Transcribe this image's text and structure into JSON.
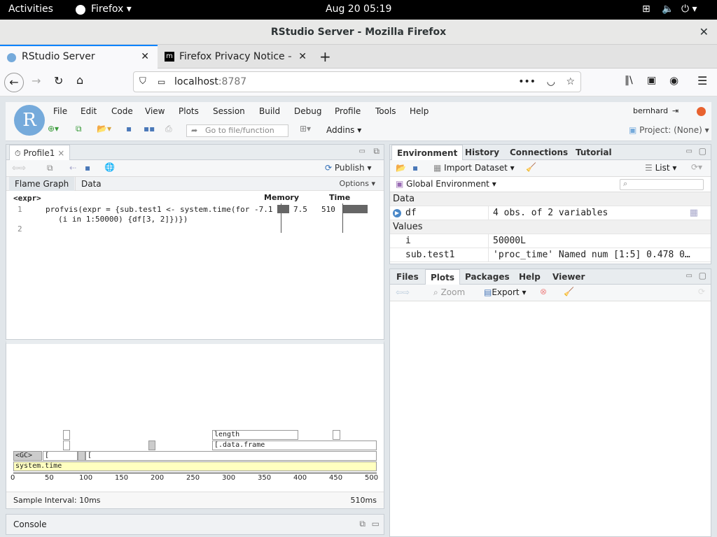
{
  "gnome": {
    "activities": "Activities",
    "app": "Firefox ▾",
    "clock": "Aug 20  05:19"
  },
  "window": {
    "title": "RStudio Server - Mozilla Firefox"
  },
  "browser": {
    "tabs": [
      {
        "label": "RStudio Server"
      },
      {
        "label": "Firefox Privacy Notice —"
      }
    ],
    "url_host": "localhost",
    "url_port": ":8787"
  },
  "rstudio": {
    "menu": [
      "File",
      "Edit",
      "Code",
      "View",
      "Plots",
      "Session",
      "Build",
      "Debug",
      "Profile",
      "Tools",
      "Help"
    ],
    "user": "bernhard",
    "goto_placeholder": "Go to file/function",
    "addins": "Addins ▾",
    "project": "Project: (None) ▾",
    "editor": {
      "tab": "Profile1",
      "publish": "Publish ▾",
      "subtabs": [
        "Flame Graph",
        "Data"
      ],
      "options": "Options ▾",
      "expr_header": "<expr>",
      "memory_header": "Memory",
      "time_header": "Time",
      "lines": [
        {
          "num": "1",
          "code": "profvis(expr = {sub.test1 <- system.time(for",
          "code2": "(i in 1:50000) {df[3, 2]})})",
          "mem_neg": "-7.1",
          "mem_pos": "7.5",
          "time": "510"
        },
        {
          "num": "2",
          "code": "",
          "code2": ""
        }
      ]
    },
    "flame": {
      "labels": {
        "gc": "<GC>",
        "br1": "[",
        "br2": "[",
        "length": "length",
        "dataframe": "[.data.frame",
        "systime": "system.time"
      },
      "axis": [
        "0",
        "50",
        "100",
        "150",
        "200",
        "250",
        "300",
        "350",
        "400",
        "450",
        "500"
      ],
      "footer_left": "Sample Interval: 10ms",
      "footer_right": "510ms"
    },
    "console": "Console",
    "env": {
      "tabs": [
        "Environment",
        "History",
        "Connections",
        "Tutorial"
      ],
      "import": "Import Dataset ▾",
      "list": "List ▾",
      "global": "Global Environment ▾",
      "sections": {
        "data": "Data",
        "values": "Values"
      },
      "rows": [
        {
          "name": "df",
          "value": "4 obs. of 2 variables"
        },
        {
          "name": "i",
          "value": "50000L"
        },
        {
          "name": "sub.test1",
          "value": "'proc_time' Named num [1:5] 0.478 0…"
        }
      ]
    },
    "files": {
      "tabs": [
        "Files",
        "Plots",
        "Packages",
        "Help",
        "Viewer"
      ],
      "zoom": "Zoom",
      "export": "Export ▾"
    }
  }
}
